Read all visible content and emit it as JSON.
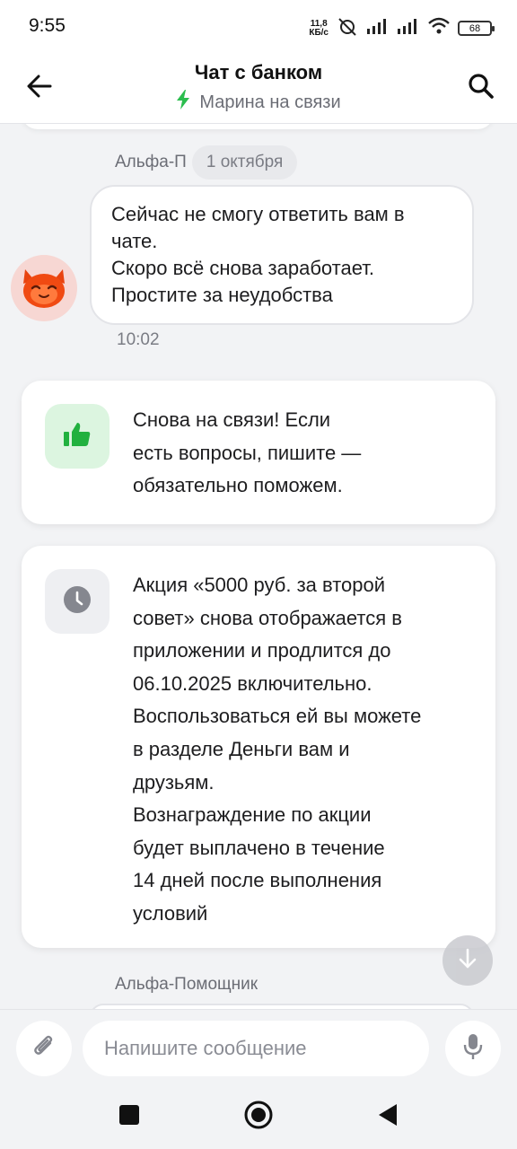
{
  "status_bar": {
    "time": "9:55",
    "net_speed_value": "11,8",
    "net_speed_unit": "КБ/с",
    "battery": "68"
  },
  "header": {
    "title": "Чат с банком",
    "subtitle": "Марина на связи"
  },
  "messages": {
    "first": {
      "sender": "Альфа-П",
      "date": "1 октября",
      "lines": [
        "Сейчас не смогу ответить вам в",
        "чате.",
        "Скоро всё снова заработает.",
        "Простите за неудобства"
      ],
      "time": "10:02"
    },
    "card1": {
      "lines": [
        "Снова на связи! Если",
        "есть вопросы, пишите —",
        "обязательно поможем."
      ]
    },
    "card2": {
      "lines": [
        "Акция «5000 руб. за второй",
        "совет» снова отображается в",
        "приложении и продлится до",
        "06.10.2025 включительно.",
        "Воспользоваться ей вы можете",
        "в разделе Деньги вам и",
        "друзьям.",
        "Вознаграждение по акции",
        "будет выплачено в течение",
        "14 дней после выполнения",
        "условий"
      ]
    },
    "next_sender": "Альфа-Помощник"
  },
  "composer": {
    "placeholder": "Напишите сообщение"
  },
  "colors": {
    "accent_green": "#21b13f",
    "bolt_green": "#2bbd4e",
    "clock_gray": "#85878f"
  }
}
